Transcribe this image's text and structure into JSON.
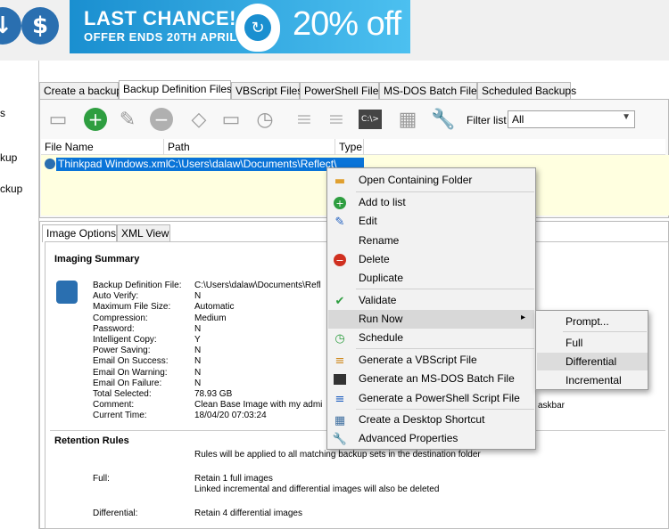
{
  "banner": {
    "line1": "LAST CHANCE!",
    "line2": "OFFER ENDS 20TH APRIL",
    "discount": "20% off"
  },
  "top_icons": [
    {
      "name": "globe-download-icon",
      "glyph": "↓"
    },
    {
      "name": "dollar-icon",
      "glyph": "$"
    }
  ],
  "left_pane": {
    "items": [
      "s",
      "kup",
      "ckup"
    ]
  },
  "tabs": [
    "Create a backup",
    "Backup Definition Files",
    "VBScript Files",
    "PowerShell Files",
    "MS-DOS Batch Files",
    "Scheduled Backups"
  ],
  "toolbar": {
    "filter_label": "Filter list",
    "filter_value": "All"
  },
  "list": {
    "columns": [
      "File Name",
      "Path",
      "Type"
    ],
    "rows": [
      {
        "name": "Thinkpad Windows.xml",
        "path": "C:\\Users\\dalaw\\Documents\\Reflect\\"
      }
    ]
  },
  "lower_tabs": [
    "Image Options",
    "XML View"
  ],
  "imaging_summary": {
    "title": "Imaging Summary",
    "fields": [
      {
        "k": "Backup Definition File:",
        "v": "C:\\Users\\dalaw\\Documents\\Refl"
      },
      {
        "k": "Auto Verify:",
        "v": "N"
      },
      {
        "k": "Maximum File Size:",
        "v": "Automatic"
      },
      {
        "k": "Compression:",
        "v": "Medium"
      },
      {
        "k": "Password:",
        "v": "N"
      },
      {
        "k": "Intelligent Copy:",
        "v": "Y"
      },
      {
        "k": "Power Saving:",
        "v": "N"
      },
      {
        "k": "Email On Success:",
        "v": "N"
      },
      {
        "k": "Email On Warning:",
        "v": "N"
      },
      {
        "k": "Email On Failure:",
        "v": "N"
      },
      {
        "k": "Total Selected:",
        "v": "78.93 GB"
      },
      {
        "k": "Comment:",
        "v": "Clean Base Image with my admi"
      },
      {
        "k": "Current Time:",
        "v": "18/04/20 07:03:24"
      }
    ],
    "comment_tail": "askbar"
  },
  "retention": {
    "title": "Retention Rules",
    "intro": "Rules will be applied to all matching backup sets in the destination folder",
    "full_label": "Full:",
    "full_lines": [
      "Retain 1 full images",
      "Linked incremental and differential images will also be deleted"
    ],
    "diff_label": "Differential:",
    "diff_line": "Retain 4 differential images"
  },
  "context_menu": {
    "items": [
      {
        "label": "Open Containing Folder",
        "icon": "folder-icon",
        "glyph": "▬",
        "color": "#e0a030"
      },
      {
        "label": "Add to list",
        "icon": "add-icon",
        "glyph": "+",
        "color": "#2e9e40"
      },
      {
        "label": "Edit",
        "icon": "pencil-icon",
        "glyph": "✎",
        "color": "#2060c0"
      },
      {
        "label": "Rename",
        "icon": "",
        "glyph": "",
        "color": ""
      },
      {
        "label": "Delete",
        "icon": "delete-icon",
        "glyph": "−",
        "color": "#d03020"
      },
      {
        "label": "Duplicate",
        "icon": "",
        "glyph": "",
        "color": ""
      },
      {
        "label": "Validate",
        "icon": "validate-icon",
        "glyph": "✔",
        "color": "#2e9e40"
      },
      {
        "label": "Run Now",
        "icon": "",
        "glyph": "",
        "color": "",
        "submenu_arrow": "▸"
      },
      {
        "label": "Schedule",
        "icon": "schedule-icon",
        "glyph": "◷",
        "color": "#2e9e40"
      },
      {
        "label": "Generate a VBScript File",
        "icon": "vbscript-icon",
        "glyph": "≡",
        "color": "#d08a20"
      },
      {
        "label": "Generate an MS-DOS Batch File",
        "icon": "batch-icon",
        "glyph": "▪",
        "color": "#333333"
      },
      {
        "label": "Generate a PowerShell Script File",
        "icon": "powershell-icon",
        "glyph": "≡",
        "color": "#2060c0"
      },
      {
        "label": "Create a Desktop Shortcut",
        "icon": "shortcut-icon",
        "glyph": "▦",
        "color": "#4070a0"
      },
      {
        "label": "Advanced Properties",
        "icon": "wrench-icon",
        "glyph": "🔧",
        "color": "#2060c0"
      }
    ]
  },
  "submenu": {
    "items": [
      "Prompt...",
      "Full",
      "Differential",
      "Incremental"
    ]
  },
  "colors": {
    "selection": "#0a74d8",
    "list_bg": "#ffffe0",
    "banner": "#1a8fd0"
  }
}
